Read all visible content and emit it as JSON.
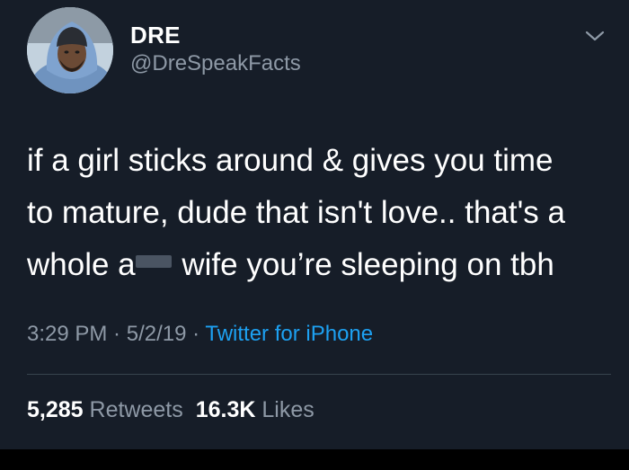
{
  "user": {
    "display_name": "DRE",
    "handle": "@DreSpeakFacts",
    "avatar_icon": "user-avatar"
  },
  "menu": {
    "icon": "chevron-down-icon"
  },
  "tweet": {
    "lines": [
      "if a girl sticks around & gives you time",
      "to mature, dude that isn't love.. that's a"
    ],
    "line3_prefix": "whole a",
    "line3_suffix": " wife you’re sleeping on tbh"
  },
  "meta": {
    "time": "3:29 PM",
    "sep1": " · ",
    "date": "5/2/19",
    "sep2": " · ",
    "source": "Twitter for iPhone"
  },
  "stats": {
    "retweets_count": "5,285",
    "retweets_label": " Retweets",
    "likes_count": "16.3K",
    "likes_label": " Likes"
  },
  "colors": {
    "background": "#161d28",
    "text_primary": "#ffffff",
    "text_secondary": "#8e99a6",
    "link": "#1da1f2",
    "divider": "#38444d"
  }
}
